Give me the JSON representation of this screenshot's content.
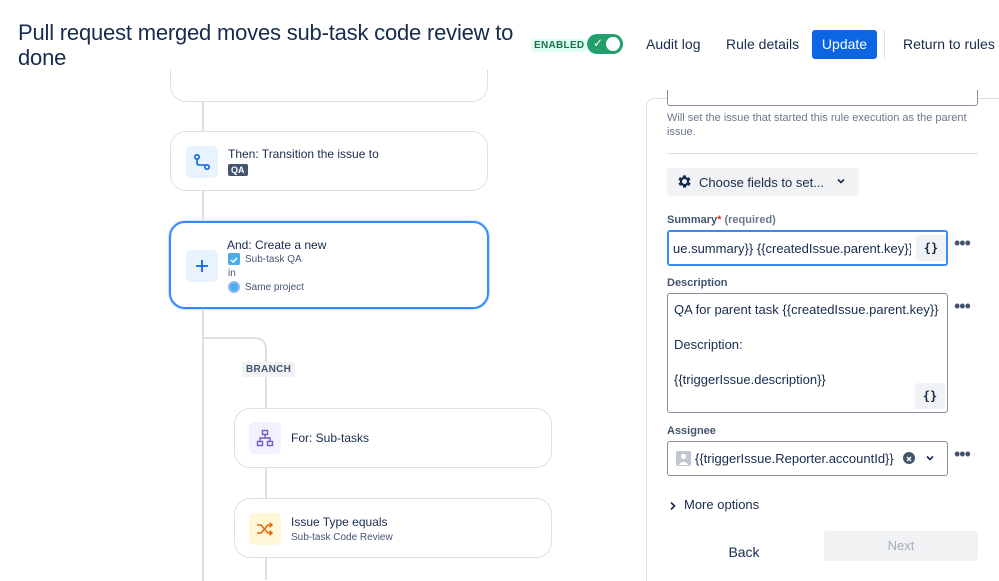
{
  "header": {
    "title": "Pull request merged moves sub-task code review to done",
    "enabled_label": "ENABLED",
    "audit_log": "Audit log",
    "rule_details": "Rule details",
    "update": "Update",
    "return_to_rules": "Return to rules"
  },
  "flow": {
    "transition": {
      "title": "Then: Transition the issue to",
      "status": "QA"
    },
    "create": {
      "title": "And: Create a new",
      "issue_type": "Sub-task QA",
      "in": "in",
      "project": "Same project"
    },
    "branch": "BRANCH",
    "for_subtasks": {
      "title": "For: Sub-tasks"
    },
    "condition": {
      "title": "Issue Type equals",
      "value": "Sub-task Code Review"
    }
  },
  "panel": {
    "parent_help": "Will set the issue that started this rule execution as the parent issue.",
    "choose_fields": "Choose fields to set...",
    "summary": {
      "label": "Summary",
      "required_star": "*",
      "required_text": "(required)",
      "value": "ue.summary}} {{createdIssue.parent.key}}",
      "brace": "{}"
    },
    "description": {
      "label": "Description",
      "line1": "QA for parent task {{createdIssue.parent.key}}",
      "line2": "Description:",
      "line3": "{{triggerIssue.description}}",
      "brace": "{}"
    },
    "assignee": {
      "label": "Assignee",
      "value": "{{triggerIssue.Reporter.accountId}}"
    },
    "more_options": "More options",
    "back": "Back",
    "next": "Next",
    "more_actions": "•••"
  },
  "colors": {
    "primary": "#0c66e4",
    "enabled_green": "#22a06b",
    "selected_border": "#388bff"
  }
}
